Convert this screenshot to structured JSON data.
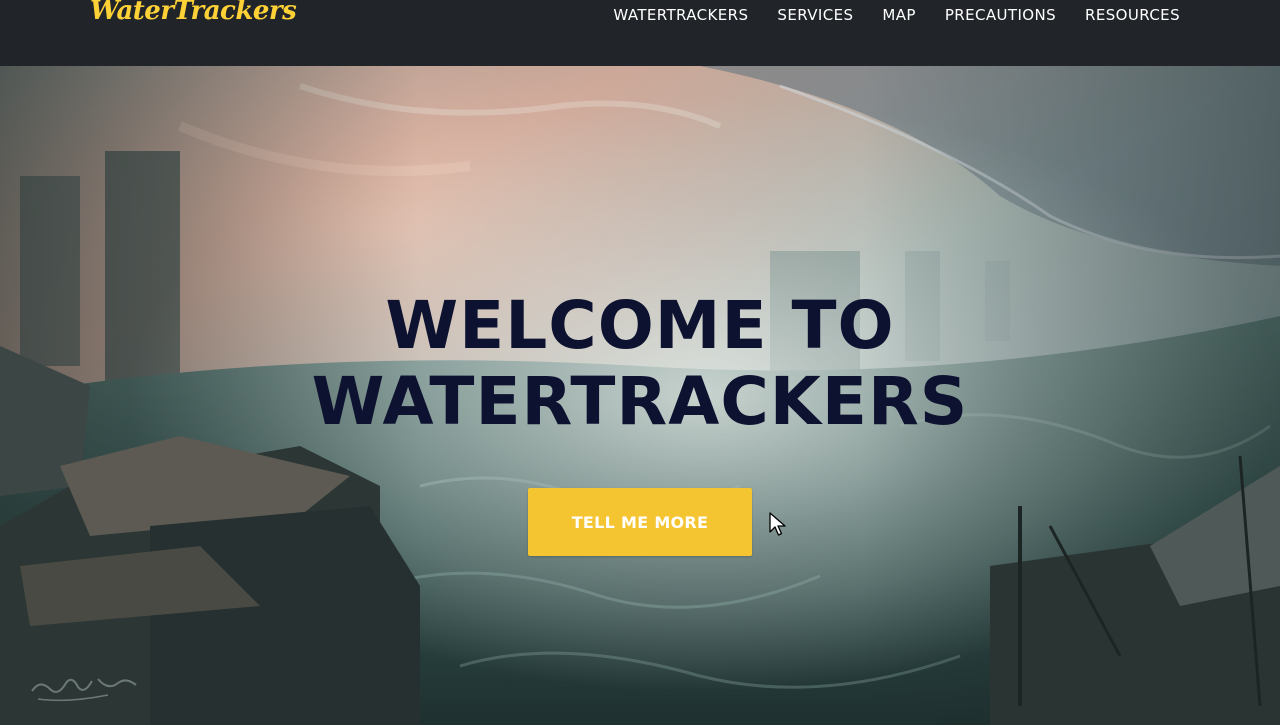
{
  "brand": {
    "name": "WaterTrackers",
    "color": "#fed136"
  },
  "nav": {
    "items": [
      {
        "label": "WATERTRACKERS"
      },
      {
        "label": "SERVICES"
      },
      {
        "label": "MAP"
      },
      {
        "label": "PRECAUTIONS"
      },
      {
        "label": "RESOURCES"
      }
    ]
  },
  "hero": {
    "heading_line1": "WELCOME TO",
    "heading_line2": "WATERTRACKERS",
    "cta_label": "TELL ME MORE",
    "cta_color": "#f4c431",
    "heading_color": "#0d1230"
  },
  "colors": {
    "navbar_bg": "#212529"
  },
  "icons": [
    "mouse-pointer-icon"
  ]
}
